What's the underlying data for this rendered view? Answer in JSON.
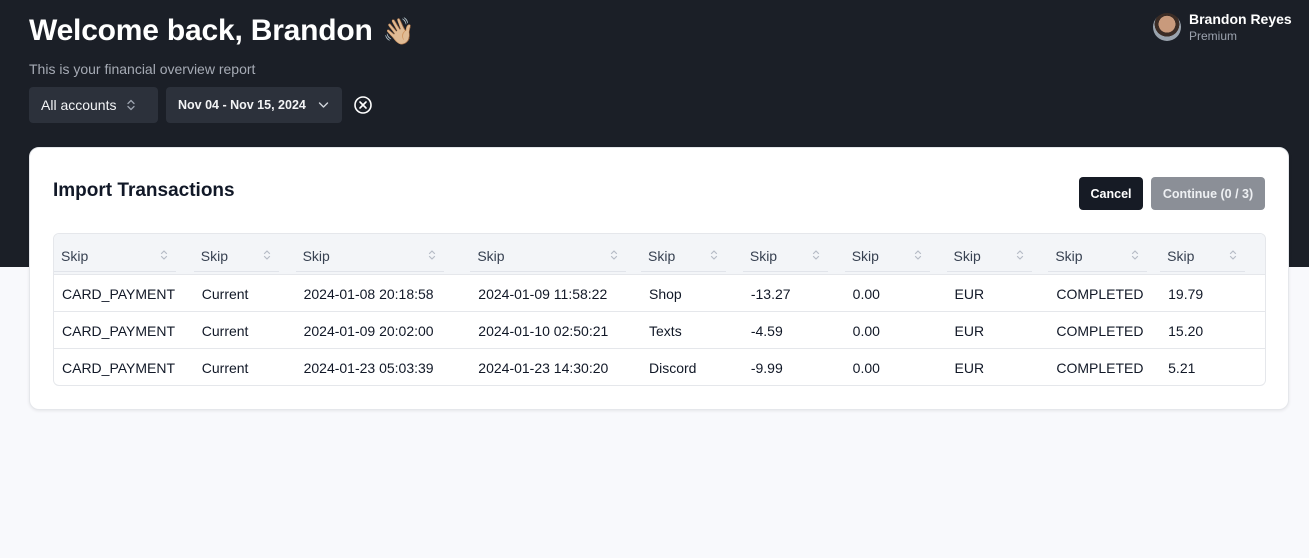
{
  "header": {
    "welcome": "Welcome back, Brandon",
    "wave_emoji": "👋🏼",
    "subtitle": "This is your financial overview report",
    "account_filter": "All accounts",
    "date_range": "Nov 04 - Nov 15, 2024"
  },
  "user": {
    "name": "Brandon Reyes",
    "plan": "Premium"
  },
  "card": {
    "title": "Import Transactions",
    "cancel_label": "Cancel",
    "continue_label": "Continue (0 / 3)"
  },
  "table": {
    "headers": [
      "Skip",
      "Skip",
      "Skip",
      "Skip",
      "Skip",
      "Skip",
      "Skip",
      "Skip",
      "Skip",
      "Skip"
    ],
    "rows": [
      [
        "CARD_PAYMENT",
        "Current",
        "2024-01-08 20:18:58",
        "2024-01-09 11:58:22",
        "Shop",
        "-13.27",
        "0.00",
        "EUR",
        "COMPLETED",
        "19.79"
      ],
      [
        "CARD_PAYMENT",
        "Current",
        "2024-01-09 20:02:00",
        "2024-01-10 02:50:21",
        "Texts",
        "-4.59",
        "0.00",
        "EUR",
        "COMPLETED",
        "15.20"
      ],
      [
        "CARD_PAYMENT",
        "Current",
        "2024-01-23 05:03:39",
        "2024-01-23 14:30:20",
        "Discord",
        "-9.99",
        "0.00",
        "EUR",
        "COMPLETED",
        "5.21"
      ]
    ]
  },
  "colors": {
    "hero_bg": "#1b1f27",
    "page_bg": "#f8f9fc",
    "primary_button": "#161b25",
    "disabled_button": "#8b8f97"
  }
}
